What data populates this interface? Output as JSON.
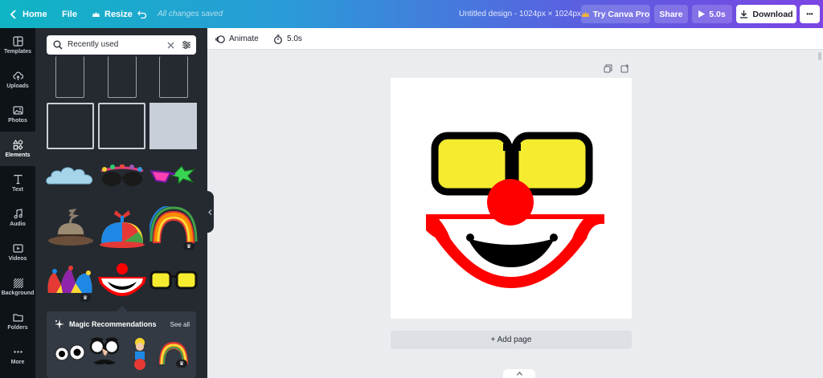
{
  "topbar": {
    "home_label": "Home",
    "file_label": "File",
    "resize_label": "Resize",
    "saved_status": "All changes saved",
    "design_title": "Untitled design - 1024px × 1024px",
    "try_pro_label": "Try Canva Pro",
    "share_label": "Share",
    "play_label": "5.0s",
    "download_label": "Download",
    "more_label": "•••"
  },
  "rail": {
    "items": [
      {
        "label": "Templates",
        "icon": "templates-icon"
      },
      {
        "label": "Uploads",
        "icon": "cloud-upload-icon"
      },
      {
        "label": "Photos",
        "icon": "photo-icon"
      },
      {
        "label": "Elements",
        "icon": "shapes-icon"
      },
      {
        "label": "Text",
        "icon": "text-icon"
      },
      {
        "label": "Audio",
        "icon": "music-note-icon"
      },
      {
        "label": "Videos",
        "icon": "video-icon"
      },
      {
        "label": "Background",
        "icon": "hatch-icon"
      },
      {
        "label": "Folders",
        "icon": "folder-icon"
      },
      {
        "label": "More",
        "icon": "dots-icon"
      }
    ],
    "active": "Elements"
  },
  "panel": {
    "search_value": "Recently used",
    "magic": {
      "title": "Magic Recommendations",
      "see_all": "See all"
    }
  },
  "toolbar": {
    "animate_label": "Animate",
    "duration_label": "5.0s"
  },
  "canvas": {
    "add_page_label": "+ Add page"
  },
  "colors": {
    "clown_red": "#ff0000",
    "glasses_yellow": "#f5ec2f",
    "panel_bg": "#252a31",
    "rail_bg": "#0e1318",
    "editor_bg": "#ebecf0"
  }
}
